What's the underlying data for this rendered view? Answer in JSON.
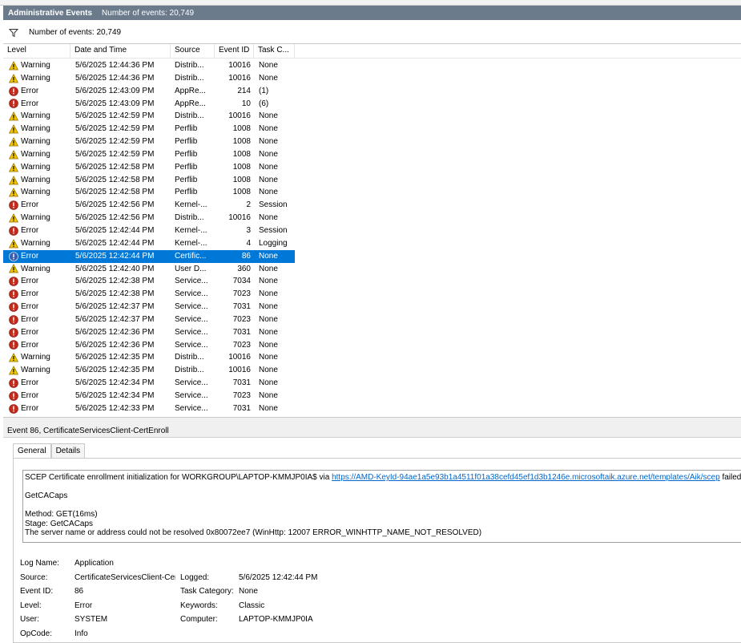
{
  "title_bar": {
    "title": "Administrative Events",
    "count": "Number of events: 20,749"
  },
  "filter_bar": {
    "icon": "filter-icon",
    "text": "Number of events: 20,749"
  },
  "columns": [
    "Level",
    "Date and Time",
    "Source",
    "Event ID",
    "Task C..."
  ],
  "events": [
    {
      "level": "Warning",
      "date": "5/6/2025 12:44:36 PM",
      "source": "Distrib...",
      "id": "10016",
      "task": "None"
    },
    {
      "level": "Warning",
      "date": "5/6/2025 12:44:36 PM",
      "source": "Distrib...",
      "id": "10016",
      "task": "None"
    },
    {
      "level": "Error",
      "date": "5/6/2025 12:43:09 PM",
      "source": "AppRe...",
      "id": "214",
      "task": "(1)"
    },
    {
      "level": "Error",
      "date": "5/6/2025 12:43:09 PM",
      "source": "AppRe...",
      "id": "10",
      "task": "(6)"
    },
    {
      "level": "Warning",
      "date": "5/6/2025 12:42:59 PM",
      "source": "Distrib...",
      "id": "10016",
      "task": "None"
    },
    {
      "level": "Warning",
      "date": "5/6/2025 12:42:59 PM",
      "source": "Perflib",
      "id": "1008",
      "task": "None"
    },
    {
      "level": "Warning",
      "date": "5/6/2025 12:42:59 PM",
      "source": "Perflib",
      "id": "1008",
      "task": "None"
    },
    {
      "level": "Warning",
      "date": "5/6/2025 12:42:59 PM",
      "source": "Perflib",
      "id": "1008",
      "task": "None"
    },
    {
      "level": "Warning",
      "date": "5/6/2025 12:42:58 PM",
      "source": "Perflib",
      "id": "1008",
      "task": "None"
    },
    {
      "level": "Warning",
      "date": "5/6/2025 12:42:58 PM",
      "source": "Perflib",
      "id": "1008",
      "task": "None"
    },
    {
      "level": "Warning",
      "date": "5/6/2025 12:42:58 PM",
      "source": "Perflib",
      "id": "1008",
      "task": "None"
    },
    {
      "level": "Error",
      "date": "5/6/2025 12:42:56 PM",
      "source": "Kernel-...",
      "id": "2",
      "task": "Session"
    },
    {
      "level": "Warning",
      "date": "5/6/2025 12:42:56 PM",
      "source": "Distrib...",
      "id": "10016",
      "task": "None"
    },
    {
      "level": "Error",
      "date": "5/6/2025 12:42:44 PM",
      "source": "Kernel-...",
      "id": "3",
      "task": "Session"
    },
    {
      "level": "Warning",
      "date": "5/6/2025 12:42:44 PM",
      "source": "Kernel-...",
      "id": "4",
      "task": "Logging"
    },
    {
      "level": "Error",
      "date": "5/6/2025 12:42:44 PM",
      "source": "Certific...",
      "id": "86",
      "task": "None",
      "selected": true
    },
    {
      "level": "Warning",
      "date": "5/6/2025 12:42:40 PM",
      "source": "User D...",
      "id": "360",
      "task": "None"
    },
    {
      "level": "Error",
      "date": "5/6/2025 12:42:38 PM",
      "source": "Service...",
      "id": "7034",
      "task": "None"
    },
    {
      "level": "Error",
      "date": "5/6/2025 12:42:38 PM",
      "source": "Service...",
      "id": "7023",
      "task": "None"
    },
    {
      "level": "Error",
      "date": "5/6/2025 12:42:37 PM",
      "source": "Service...",
      "id": "7031",
      "task": "None"
    },
    {
      "level": "Error",
      "date": "5/6/2025 12:42:37 PM",
      "source": "Service...",
      "id": "7023",
      "task": "None"
    },
    {
      "level": "Error",
      "date": "5/6/2025 12:42:36 PM",
      "source": "Service...",
      "id": "7031",
      "task": "None"
    },
    {
      "level": "Error",
      "date": "5/6/2025 12:42:36 PM",
      "source": "Service...",
      "id": "7023",
      "task": "None"
    },
    {
      "level": "Warning",
      "date": "5/6/2025 12:42:35 PM",
      "source": "Distrib...",
      "id": "10016",
      "task": "None"
    },
    {
      "level": "Warning",
      "date": "5/6/2025 12:42:35 PM",
      "source": "Distrib...",
      "id": "10016",
      "task": "None"
    },
    {
      "level": "Error",
      "date": "5/6/2025 12:42:34 PM",
      "source": "Service...",
      "id": "7031",
      "task": "None"
    },
    {
      "level": "Error",
      "date": "5/6/2025 12:42:34 PM",
      "source": "Service...",
      "id": "7023",
      "task": "None"
    },
    {
      "level": "Error",
      "date": "5/6/2025 12:42:33 PM",
      "source": "Service...",
      "id": "7031",
      "task": "None"
    }
  ],
  "detail": {
    "header": "Event 86, CertificateServicesClient-CertEnroll",
    "tabs": {
      "general": "General",
      "details": "Details"
    },
    "message": {
      "line1_prefix": "SCEP Certificate enrollment initialization for WORKGROUP\\LAPTOP-KMMJP0IA$ via ",
      "line1_link": "https://AMD-KeyId-94ae1a5e93b1a4511f01a38cefd45ef1d3b1246e.microsoftaik.azure.net/templates/Aik/scep",
      "line1_suffix": " failed:",
      "line2": "GetCACaps",
      "line3": "Method: GET(16ms)",
      "line4": "Stage: GetCACaps",
      "line5": "The server name or address could not be resolved 0x80072ee7 (WinHttp: 12007 ERROR_WINHTTP_NAME_NOT_RESOLVED)"
    },
    "props": {
      "log_name_label": "Log Name:",
      "log_name": "Application",
      "source_label": "Source:",
      "source": "CertificateServicesClient-Cer",
      "logged_label": "Logged:",
      "logged": "5/6/2025 12:42:44 PM",
      "event_id_label": "Event ID:",
      "event_id": "86",
      "task_category_label": "Task Category:",
      "task_category": "None",
      "level_label": "Level:",
      "level": "Error",
      "keywords_label": "Keywords:",
      "keywords": "Classic",
      "user_label": "User:",
      "user": "SYSTEM",
      "computer_label": "Computer:",
      "computer": "LAPTOP-KMMJP0IA",
      "opcode_label": "OpCode:",
      "opcode": "Info"
    }
  }
}
